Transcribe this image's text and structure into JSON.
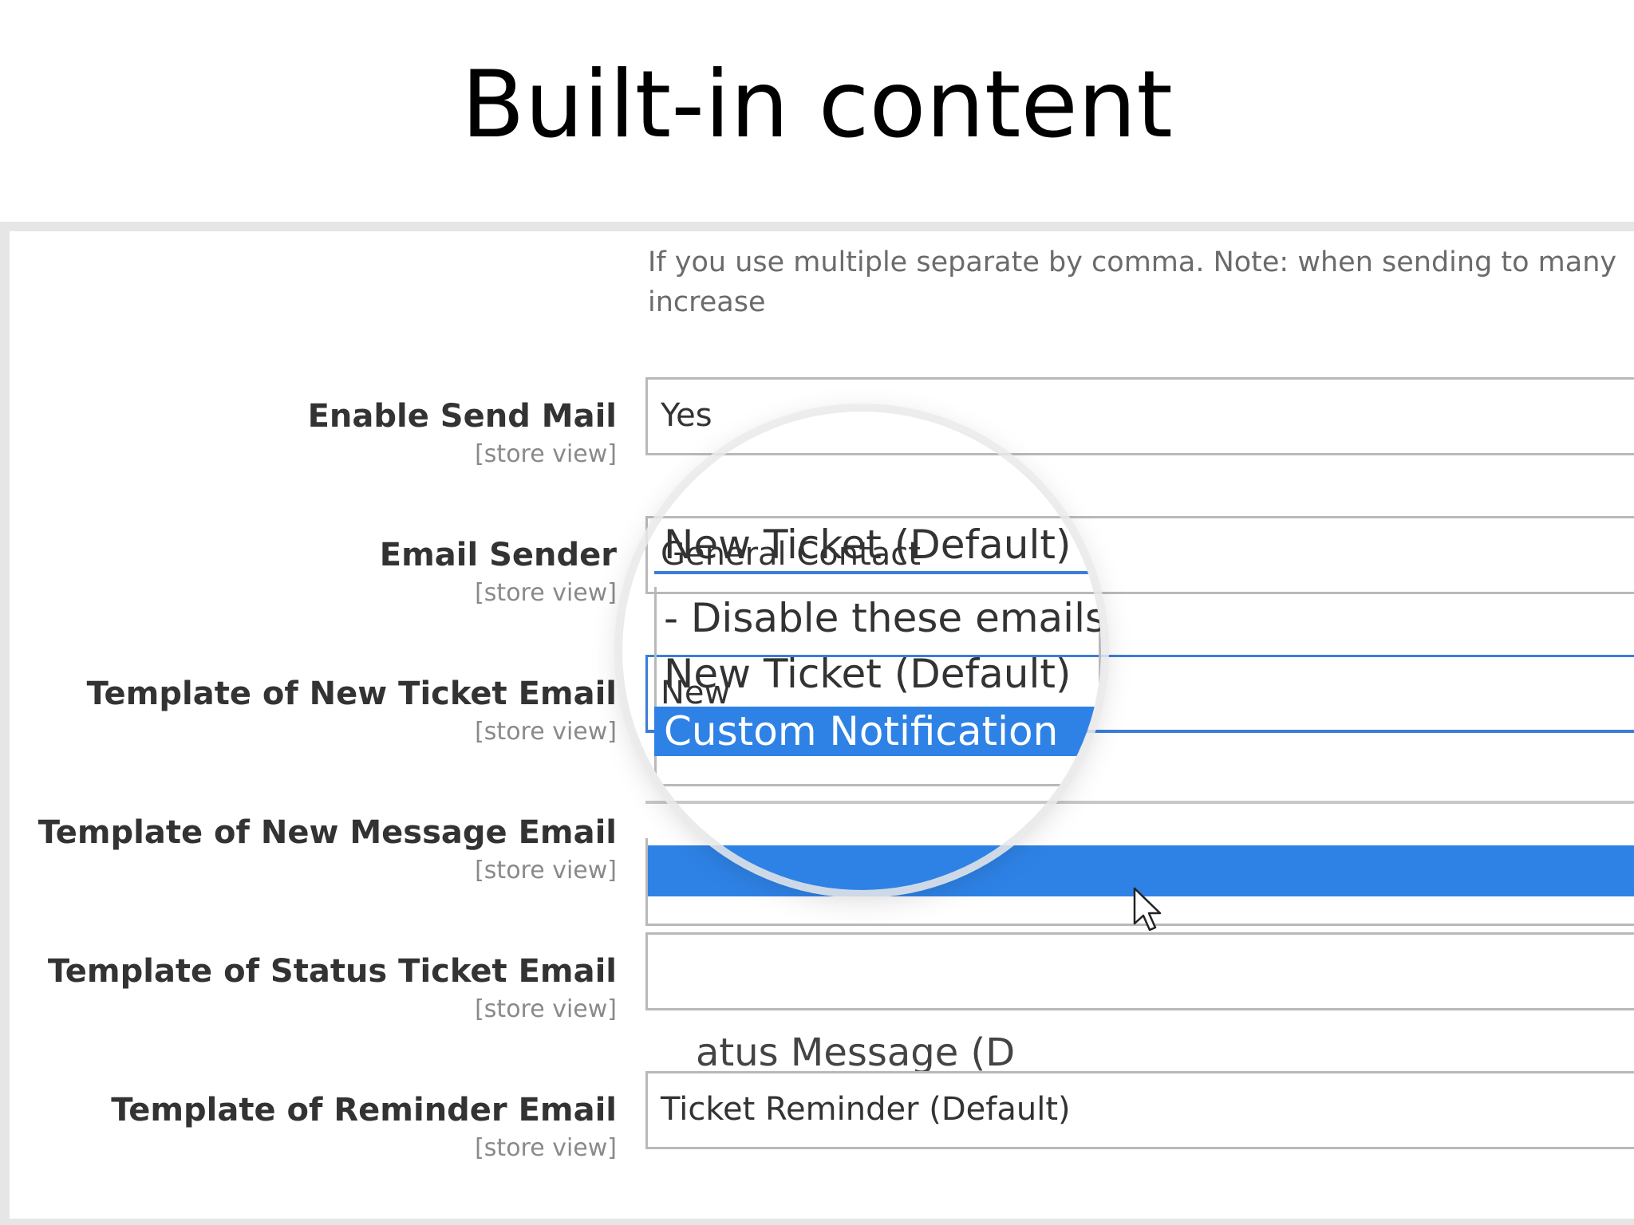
{
  "title": "Built-in content",
  "note": "If you use multiple separate by comma. Note: when sending to many increase",
  "scope_label": "[store view]",
  "fields": [
    {
      "label": "Enable Send Mail",
      "value": "Yes"
    },
    {
      "label": "Email Sender",
      "value": "General Contact"
    },
    {
      "label": "Template of New Ticket Email",
      "value": "New"
    },
    {
      "label": "Template of New Message Email",
      "value": ""
    },
    {
      "label": "Template of Status Ticket Email",
      "value": ""
    },
    {
      "label": "Template of Reminder Email",
      "value": "Ticket Reminder (Default)"
    }
  ],
  "dropdown": {
    "current_value": "New Ticket (Default)",
    "options": [
      "- Disable these emails -",
      "New Ticket (Default)",
      "Custom Notification"
    ],
    "selected": "Custom Notification"
  },
  "partial_text": "atus Message (D",
  "colors": {
    "highlight": "#2e82e6",
    "active_border": "#3b7dd8"
  }
}
